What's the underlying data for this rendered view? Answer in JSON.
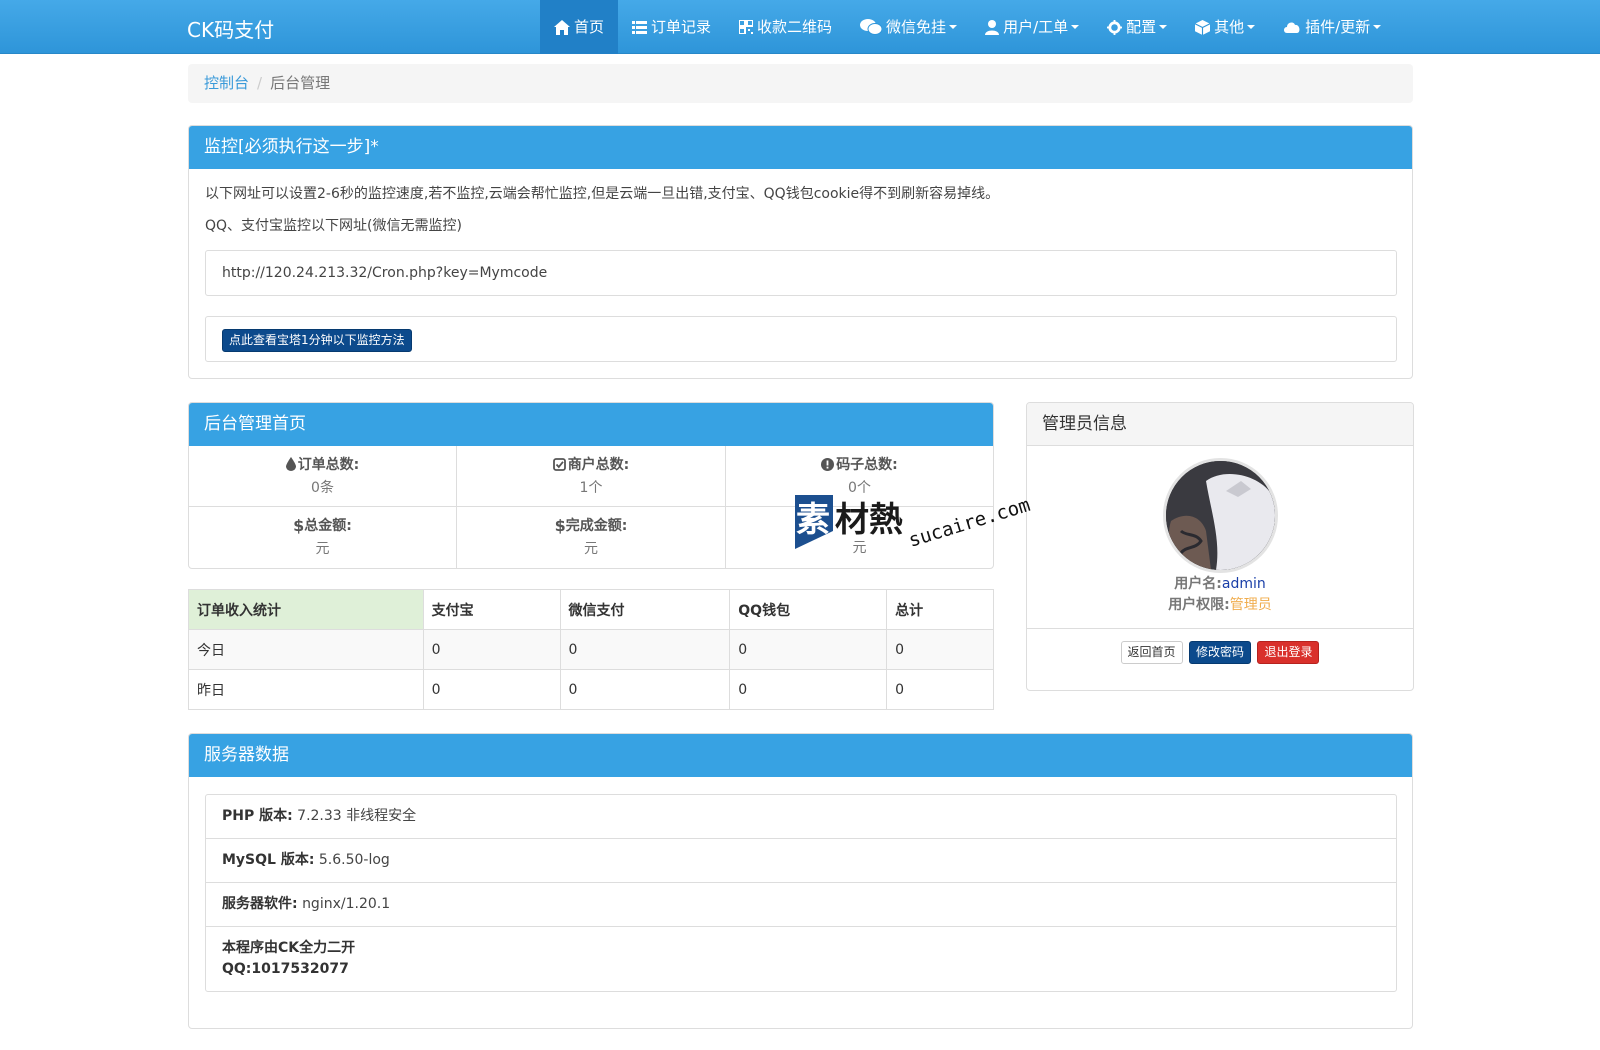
{
  "navbar": {
    "brand": "CK码支付",
    "items": [
      {
        "label": "首页",
        "icon": "home-icon",
        "active": true
      },
      {
        "label": "订单记录",
        "icon": "list-icon"
      },
      {
        "label": "收款二维码",
        "icon": "qrcode-icon"
      },
      {
        "label": "微信免挂",
        "icon": "wechat-icon",
        "dropdown": true
      },
      {
        "label": "用户/工单",
        "icon": "user-icon",
        "dropdown": true
      },
      {
        "label": "配置",
        "icon": "gear-icon",
        "dropdown": true
      },
      {
        "label": "其他",
        "icon": "cube-icon",
        "dropdown": true
      },
      {
        "label": "插件/更新",
        "icon": "cloud-icon",
        "dropdown": true
      }
    ]
  },
  "breadcrumb": {
    "home": "控制台",
    "separator": "/",
    "current": "后台管理"
  },
  "monitor": {
    "title": "监控[必须执行这一步]*",
    "line1": "以下网址可以设置2-6秒的监控速度,若不监控,云端会帮忙监控,但是云端一旦出错,支付宝、QQ钱包cookie得不到刷新容易掉线。",
    "line2": "QQ、支付宝监控以下网址(微信无需监控)",
    "url": "http://120.24.213.32/Cron.php?key=Mymcode",
    "button": "点此查看宝塔1分钟以下监控方法"
  },
  "admin_home": {
    "title": "后台管理首页",
    "stats": [
      {
        "label": "订单总数:",
        "value": "0条",
        "icon": "drop-icon"
      },
      {
        "label": "商户总数:",
        "value": "1个",
        "icon": "check-square-icon"
      },
      {
        "label": "码子总数:",
        "value": "0个",
        "icon": "exclamation-circle-icon"
      },
      {
        "label": "总金额:",
        "value": "元",
        "icon": "dollar-icon"
      },
      {
        "label": "完成金额:",
        "value": "元",
        "icon": "dollar-icon"
      },
      {
        "label": "",
        "value": "元",
        "icon": ""
      }
    ]
  },
  "income": {
    "headers": [
      "订单收入统计",
      "支付宝",
      "微信支付",
      "QQ钱包",
      "总计"
    ],
    "rows": [
      [
        "今日",
        "0",
        "0",
        "0",
        "0"
      ],
      [
        "昨日",
        "0",
        "0",
        "0",
        "0"
      ]
    ]
  },
  "manager": {
    "title": "管理员信息",
    "username_label": "用户名:",
    "username": "admin",
    "role_label": "用户权限:",
    "role": "管理员",
    "buttons": {
      "home": "返回首页",
      "change_password": "修改密码",
      "logout": "退出登录"
    }
  },
  "server": {
    "title": "服务器数据",
    "rows": [
      {
        "label": "PHP 版本:",
        "value": "7.2.33 非线程安全"
      },
      {
        "label": "MySQL 版本:",
        "value": "5.6.50-log"
      },
      {
        "label": "服务器软件:",
        "value": "nginx/1.20.1"
      }
    ],
    "footer_line1": "本程序由CK全力二开",
    "footer_line2": "QQ:1017532077"
  },
  "watermark": {
    "cn": "素材熱",
    "en": "sucaire.com"
  },
  "colors": {
    "primary": "#37a2e3",
    "nav_active": "#2180c7",
    "dark_button": "#0c4a8c",
    "danger": "#d9302b",
    "warning": "#f0ad4e",
    "success_bg": "#dff0d8"
  }
}
